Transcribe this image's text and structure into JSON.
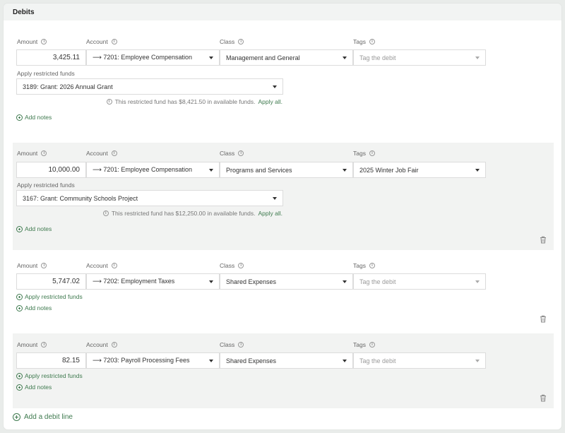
{
  "panel": {
    "title": "Debits"
  },
  "labels": {
    "amount": "Amount",
    "account": "Account",
    "class": "Class",
    "tags": "Tags",
    "apply_restricted_funds": "Apply restricted funds",
    "add_notes": "Add notes",
    "apply_all": "Apply all."
  },
  "debit_lines": [
    {
      "amount": "3,425.11",
      "account": "⟶ 7201: Employee Compensation",
      "class": "Management and General",
      "tags_placeholder": "Tag the debit",
      "restricted_fund": "3189: Grant: 2026 Annual Grant",
      "fund_hint": "This restricted fund has $8,421.50 in available funds."
    },
    {
      "amount": "10,000.00",
      "account": "⟶ 7201: Employee Compensation",
      "class": "Programs and Services",
      "tags": "2025 Winter Job Fair",
      "restricted_fund": "3167: Grant: Community Schools Project",
      "fund_hint": "This restricted fund has $12,250.00 in available funds."
    },
    {
      "amount": "5,747.02",
      "account": "⟶ 7202: Employment Taxes",
      "class": "Shared Expenses",
      "tags_placeholder": "Tag the debit"
    },
    {
      "amount": "82.15",
      "account": "⟶ 7203: Payroll Processing Fees",
      "class": "Shared Expenses",
      "tags_placeholder": "Tag the debit"
    }
  ],
  "add_debit_line": "Add a debit line",
  "icons": {
    "info": "info-circle-icon",
    "plus": "plus-circle-icon",
    "trash": "trash-icon",
    "caret": "caret-down-icon"
  },
  "colors": {
    "accent": "#3f7a4f",
    "shaded_row": "#f2f3f2"
  }
}
